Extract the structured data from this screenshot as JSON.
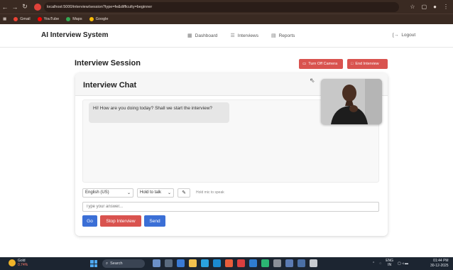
{
  "browser": {
    "url": "localhost:5000/interview/session?type=fe&difficulty=beginner",
    "bookmarks": [
      "Gmail",
      "YouTube",
      "Maps",
      "Google"
    ]
  },
  "header": {
    "brand": "AI Interview System",
    "nav": [
      "Dashboard",
      "Interviews",
      "Reports"
    ],
    "logout": "Logout"
  },
  "session": {
    "title": "Interview Session",
    "camera_btn": "Turn Off Camera",
    "end_btn": "End Interview"
  },
  "chat": {
    "title": "Interview Chat",
    "message": "Hi! How are you doing today? Shall we start the interview?",
    "language": "English (US)",
    "mode": "Hold to talk",
    "mic_hint": "Hold mic to speak",
    "answer_placeholder": "Type your answer...",
    "btn_start_label": "Go",
    "btn_stop": "Stop Interview",
    "btn_send": "Send"
  },
  "taskbar": {
    "weather_title": "Gold",
    "weather_value": "0.74%",
    "search": "Search",
    "lang": "ENG",
    "region": "IN",
    "time": "01:44 PM",
    "date": "30-12-2025"
  }
}
